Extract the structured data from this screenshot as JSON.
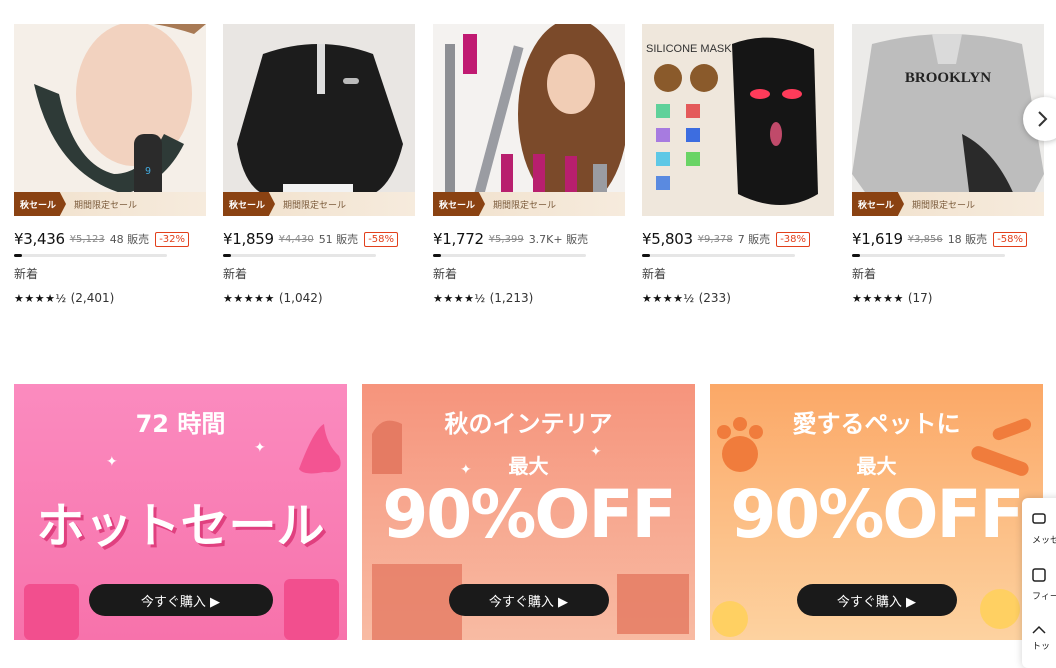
{
  "products": [
    {
      "price": "¥3,436",
      "original": "¥5,123",
      "sold": "48 販売",
      "discount": "-32%",
      "badge": "新着",
      "stars": "★★★★½",
      "rating_value": 4.5,
      "reviews": "(2,401)",
      "sale_tag": "秋セール",
      "sale_limited": "期間限定セール",
      "progress": 0.05
    },
    {
      "price": "¥1,859",
      "original": "¥4,430",
      "sold": "51 販売",
      "discount": "-58%",
      "badge": "新着",
      "stars": "★★★★★",
      "rating_value": 4.8,
      "reviews": "(1,042)",
      "sale_tag": "秋セール",
      "sale_limited": "期間限定セール",
      "progress": 0.05
    },
    {
      "price": "¥1,772",
      "original": "¥5,399",
      "sold": "3.7K+ 販売",
      "discount": "",
      "badge": "新着",
      "stars": "★★★★½",
      "rating_value": 4.5,
      "reviews": "(1,213)",
      "sale_tag": "秋セール",
      "sale_limited": "期間限定セール",
      "progress": 0.05
    },
    {
      "price": "¥5,803",
      "original": "¥9,378",
      "sold": "7 販売",
      "discount": "-38%",
      "badge": "新着",
      "stars": "★★★★½",
      "rating_value": 4.5,
      "reviews": "(233)",
      "sale_tag": "",
      "sale_limited": "",
      "image_caption": "SILICONE MASK",
      "progress": 0.05
    },
    {
      "price": "¥1,619",
      "original": "¥3,856",
      "sold": "18 販売",
      "discount": "-58%",
      "badge": "新着",
      "stars": "★★★★★",
      "rating_value": 5,
      "reviews": "(17)",
      "sale_tag": "秋セール",
      "sale_limited": "期間限定セール",
      "image_caption": "BROOKLYN",
      "progress": 0.05
    }
  ],
  "banners": [
    {
      "line1": "72 時間",
      "line2": "",
      "big": "ホットセール",
      "cta": "今すぐ購入 ▶"
    },
    {
      "line1": "秋のインテリア",
      "line2": "最大",
      "big": "90%OFF",
      "cta": "今すぐ購入 ▶"
    },
    {
      "line1": "愛するペットに",
      "line2": "最大",
      "big": "90%OFF",
      "cta": "今すぐ購入 ▶"
    }
  ],
  "side_panel": {
    "items": [
      "メッセ",
      "フィード",
      "トッ"
    ]
  },
  "colors": {
    "accent": "#e2401c",
    "banner1": "#f77fb3",
    "banner2": "#f59a83",
    "banner3": "#fbb36f"
  }
}
